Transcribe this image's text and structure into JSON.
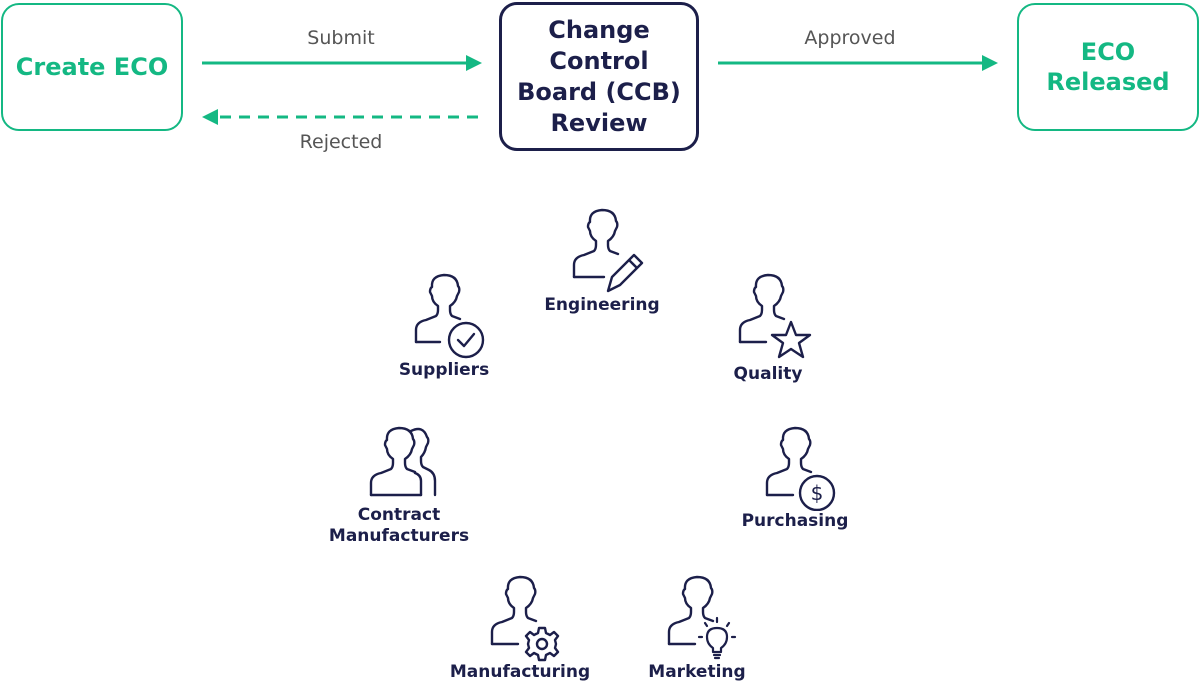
{
  "colors": {
    "accent_green": "#14b883",
    "navy": "#1c1f4a",
    "label_gray": "#555555"
  },
  "flow": {
    "create": {
      "label": "Create ECO"
    },
    "review": {
      "label": "Change Control Board (CCB) Review"
    },
    "released": {
      "label": "ECO Released"
    },
    "edges": {
      "submit": "Submit",
      "rejected": "Rejected",
      "approved": "Approved"
    }
  },
  "roles": [
    {
      "label": "Engineering",
      "icon": "person-pencil-icon"
    },
    {
      "label": "Suppliers",
      "icon": "person-check-icon"
    },
    {
      "label": "Quality",
      "icon": "person-star-icon"
    },
    {
      "label": "Contract Manufacturers",
      "icon": "two-persons-icon"
    },
    {
      "label": "Purchasing",
      "icon": "person-dollar-icon"
    },
    {
      "label": "Manufacturing",
      "icon": "person-gear-icon"
    },
    {
      "label": "Marketing",
      "icon": "person-lightbulb-icon"
    }
  ]
}
